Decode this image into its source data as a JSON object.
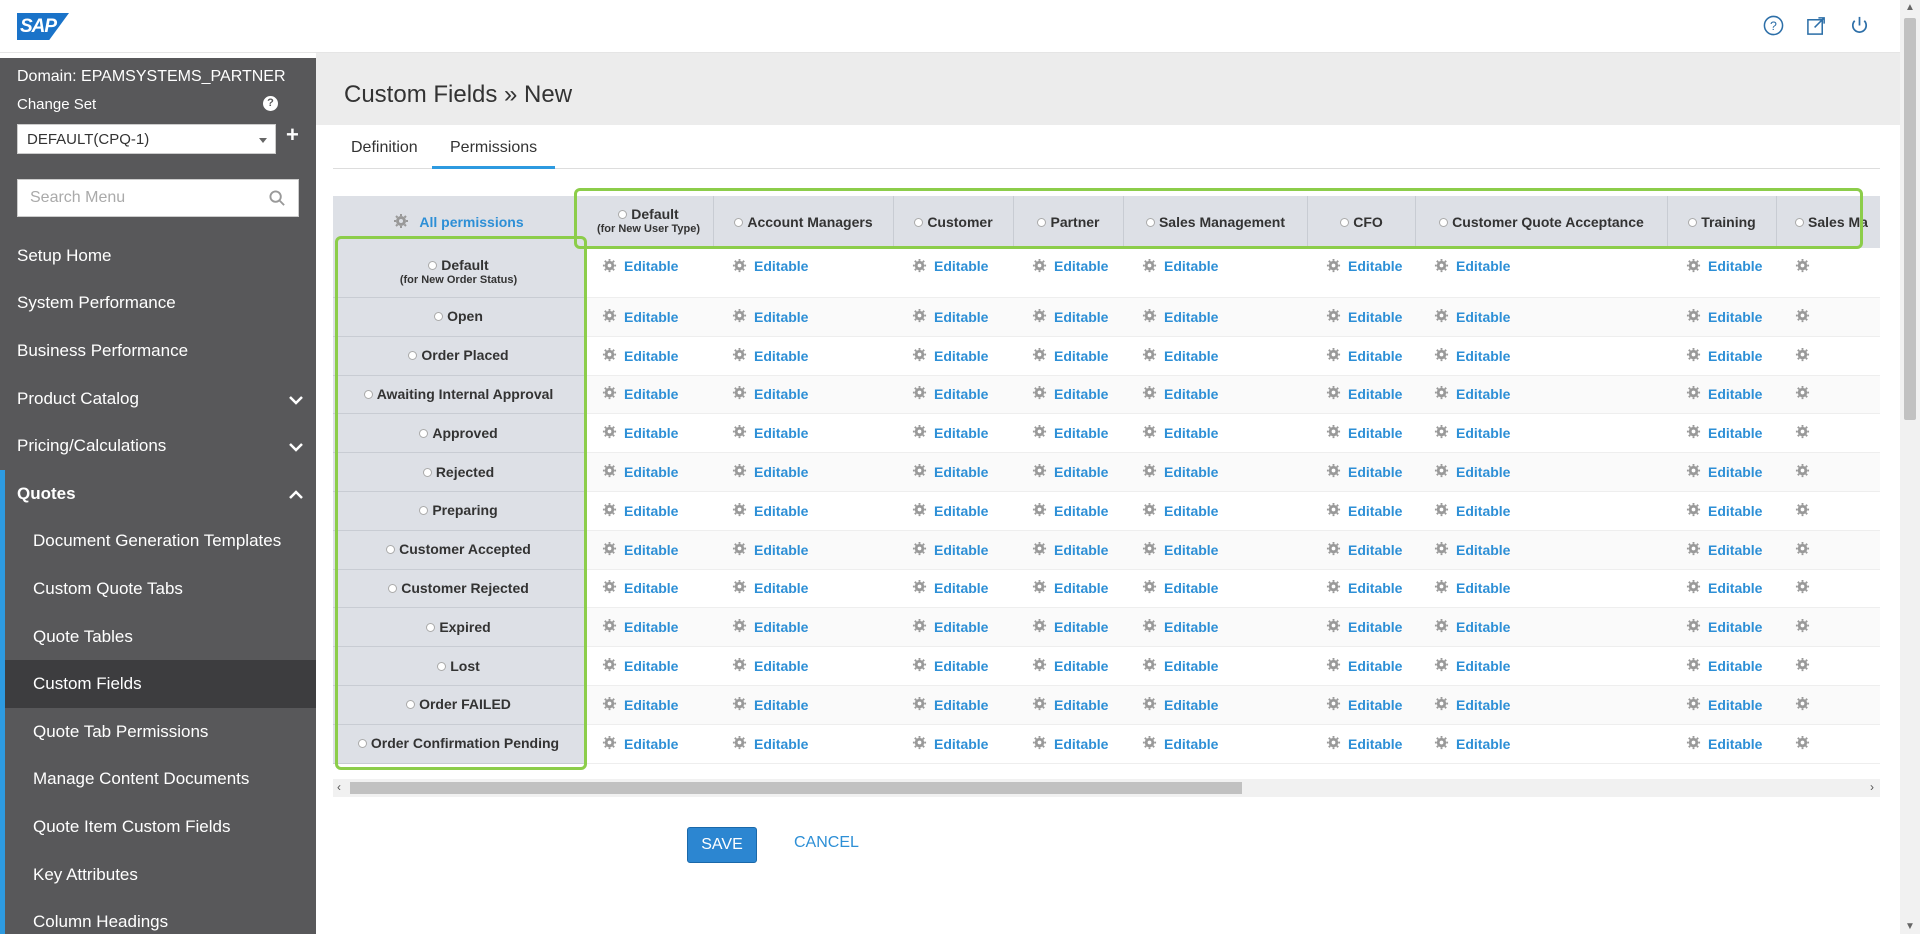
{
  "header": {
    "logo_text": "SAP",
    "icons": [
      "help-circle-icon",
      "external-window-icon",
      "power-icon"
    ]
  },
  "sidebar": {
    "domain": "Domain: EPAMSYSTEMS_PARTNER",
    "change_set_label": "Change Set",
    "change_set_value": "DEFAULT(CPQ-1)",
    "search_placeholder": "Search Menu",
    "items": [
      {
        "label": "Setup Home"
      },
      {
        "label": "System Performance"
      },
      {
        "label": "Business Performance"
      },
      {
        "label": "Product Catalog"
      },
      {
        "label": "Pricing/Calculations"
      },
      {
        "label": "Quotes"
      }
    ],
    "subitems": [
      {
        "label": "Document Generation Templates"
      },
      {
        "label": "Custom Quote Tabs"
      },
      {
        "label": "Quote Tables"
      },
      {
        "label": "Custom Fields"
      },
      {
        "label": "Quote Tab Permissions"
      },
      {
        "label": "Manage Content Documents"
      },
      {
        "label": "Quote Item Custom Fields"
      },
      {
        "label": "Key Attributes"
      },
      {
        "label": "Column Headings"
      }
    ]
  },
  "page": {
    "title": "Custom Fields » New",
    "tabs": [
      {
        "label": "Definition"
      },
      {
        "label": "Permissions"
      }
    ]
  },
  "grid": {
    "all_permissions": "All permissions",
    "columns": [
      {
        "label": "Default",
        "sub": "(for New User Type)"
      },
      {
        "label": "Account Managers",
        "sub": ""
      },
      {
        "label": "Customer",
        "sub": ""
      },
      {
        "label": "Partner",
        "sub": ""
      },
      {
        "label": "Sales Management",
        "sub": ""
      },
      {
        "label": "CFO",
        "sub": ""
      },
      {
        "label": "Customer Quote Acceptance",
        "sub": ""
      },
      {
        "label": "Training",
        "sub": ""
      },
      {
        "label": "Sales Ma",
        "sub": ""
      }
    ],
    "rows": [
      {
        "label": "Default",
        "sub": "(for New Order Status)"
      },
      {
        "label": "Open",
        "sub": ""
      },
      {
        "label": "Order Placed",
        "sub": ""
      },
      {
        "label": "Awaiting Internal Approval",
        "sub": ""
      },
      {
        "label": "Approved",
        "sub": ""
      },
      {
        "label": "Rejected",
        "sub": ""
      },
      {
        "label": "Preparing",
        "sub": ""
      },
      {
        "label": "Customer Accepted",
        "sub": ""
      },
      {
        "label": "Customer Rejected",
        "sub": ""
      },
      {
        "label": "Expired",
        "sub": ""
      },
      {
        "label": "Lost",
        "sub": ""
      },
      {
        "label": "Order FAILED",
        "sub": ""
      },
      {
        "label": "Order Confirmation Pending",
        "sub": ""
      }
    ],
    "cell_value": "Editable"
  },
  "actions": {
    "save": "SAVE",
    "cancel": "CANCEL"
  },
  "colors": {
    "accent": "#2d8fd6",
    "sidebar_bg": "#58585a",
    "highlight": "#8ccd4a"
  }
}
